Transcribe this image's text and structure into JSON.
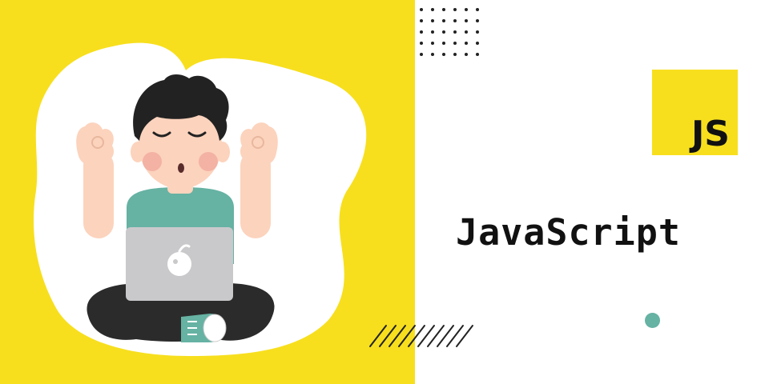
{
  "colors": {
    "brand_yellow": "#F7DF1E",
    "accent_teal": "#66B2A3",
    "text_dark": "#111111",
    "background": "#FFFFFF",
    "laptop_gray": "#C9C9CB",
    "pants_dark": "#2B2B2B",
    "skin": "#FCD3BD"
  },
  "logo": {
    "text": "JS"
  },
  "title": "JavaScript",
  "icons": [
    "js-logo-icon",
    "meditating-developer-illustration",
    "laptop-icon"
  ]
}
